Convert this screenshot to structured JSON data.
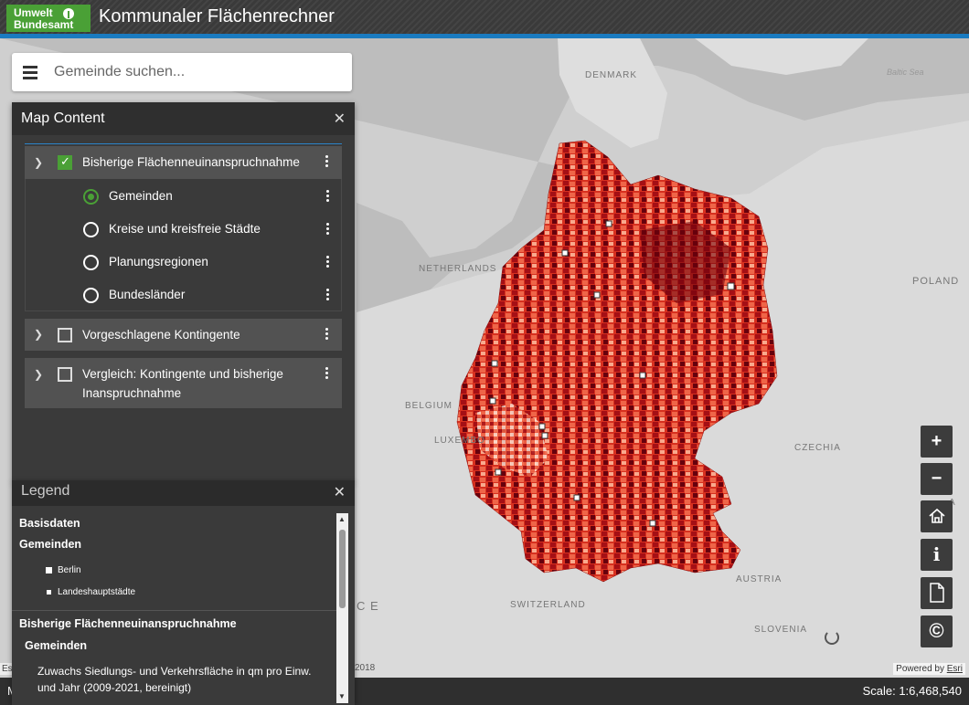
{
  "header": {
    "logo_line1": "Umwelt",
    "logo_line2": "Bundesamt",
    "title": "Kommunaler Flächenrechner",
    "accent_color": "#4aa036",
    "stripe_color": "#1a7bc0"
  },
  "search": {
    "placeholder": "Gemeinde suchen..."
  },
  "map_content": {
    "title": "Map Content",
    "close_icon": "close-icon",
    "layers": [
      {
        "label": "Bisherige Flächenneuinanspruchnahme",
        "checked": true,
        "expanded": true,
        "sublayers": [
          {
            "label": "Gemeinden",
            "selected": true
          },
          {
            "label": "Kreise und kreisfreie Städte",
            "selected": false
          },
          {
            "label": "Planungsregionen",
            "selected": false
          },
          {
            "label": "Bundesländer",
            "selected": false
          }
        ]
      },
      {
        "label": "Vorgeschlagene Kontingente",
        "checked": false,
        "expanded": false
      },
      {
        "label_line1": "Vergleich: Kontingente und bisherige",
        "label_line2": "Inanspruchnahme",
        "checked": false,
        "expanded": false
      }
    ]
  },
  "legend": {
    "title": "Legend",
    "basis_heading": "Basisdaten",
    "basis_sub": "Gemeinden",
    "basis_items": [
      "Berlin",
      "Landeshauptstädte"
    ],
    "layer_heading": "Bisherige Flächenneuinanspruchnahme",
    "layer_sub": "Gemeinden",
    "description_line1": "Zuwachs Siedlungs- und Verkehrsfläche in qm pro Einw.",
    "description_line2": "und Jahr (2009-2021, bereinigt)"
  },
  "map": {
    "labels": {
      "denmark": "DENMARK",
      "baltic": "Baltic Sea",
      "netherlands": "NETHERLANDS",
      "poland": "POLAND",
      "belgium": "BELGIUM",
      "luxembourg": "LUXEMBO",
      "czechia": "CZECHIA",
      "austria": "AUSTRIA",
      "switzerland": "SWITZERLAND",
      "slovenia": "SLOVENIA",
      "hungary": "HU",
      "slovakia": "A",
      "france": "C E"
    },
    "attribution_left": "Esri",
    "attribution_mid": "2018",
    "powered_by": "Powered by",
    "powered_by_link": "Esri",
    "fill_colors": [
      "#fde0d2",
      "#f9a98d",
      "#ef6548",
      "#d7301f",
      "#a50f15",
      "#67000d"
    ]
  },
  "tools": {
    "zoom_in": "+",
    "zoom_out": "−",
    "info": "i",
    "copyright": "©"
  },
  "statusbar": {
    "left": "M",
    "scale": "Scale: 1:6,468,540"
  }
}
